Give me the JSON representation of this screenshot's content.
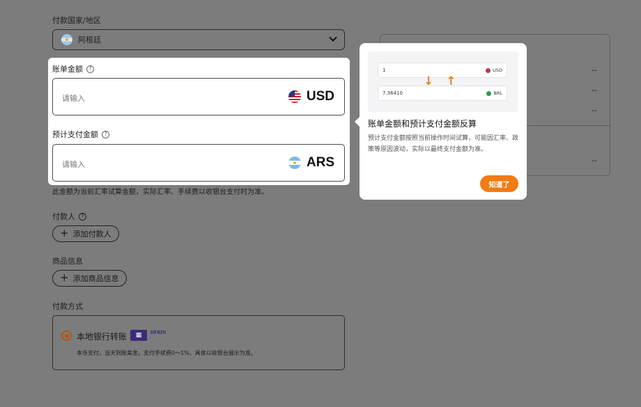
{
  "country": {
    "label": "付款国家/地区",
    "value": "阿根廷",
    "flag_icon": "argentina-flag-icon"
  },
  "summary_panel": {
    "dashes": [
      "--",
      "--",
      "--",
      "--"
    ]
  },
  "bill_amount": {
    "label": "账单金额",
    "placeholder": "请输入",
    "currency": "USD"
  },
  "estimated_amount": {
    "label": "预计支付金额",
    "placeholder": "请输入",
    "currency": "ARS"
  },
  "rate_note": "此金额为当前汇率试算金额，实际汇率、手续费以收银台支付时为准。",
  "payer": {
    "label": "付款人",
    "button": "添加付款人"
  },
  "goods": {
    "label": "商品信息",
    "button": "添加商品信息"
  },
  "payment": {
    "label": "付款方式",
    "option": "本地银行转账",
    "brand": "DFRIN",
    "desc": "本币支付，当天到账美金。支付手续费0～1%，具体以收银台展示为准。"
  },
  "popover": {
    "illustration": {
      "row1_value": "1",
      "row1_currency": "USD",
      "row2_value": "7.36410",
      "row2_currency": "BRL"
    },
    "title": "账单金额和预计支付金额反算",
    "body": "预计支付金额按照当前操作时间试算，可能因汇率、政策等原因波动，实际以最终支付金额为准。",
    "button": "知道了"
  },
  "colors": {
    "accent": "#f27b14",
    "overlay": "#7c7c7c",
    "radio": "#b75312"
  }
}
